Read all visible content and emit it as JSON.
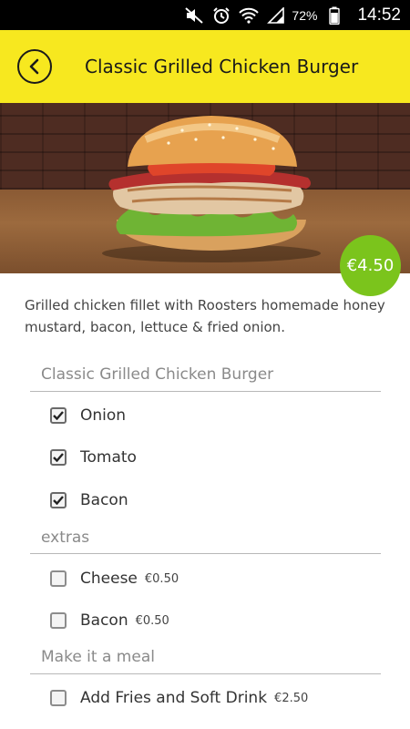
{
  "status_bar": {
    "icons": [
      "mute-icon",
      "alarm-icon",
      "wifi-icon",
      "signal-icon",
      "battery-icon"
    ],
    "battery": "72%",
    "time": "14:52"
  },
  "header": {
    "title": "Classic Grilled Chicken Burger",
    "back_icon": "chevron-left-icon",
    "background": "#f7e81f"
  },
  "product": {
    "price": "€4.50",
    "price_color": "#7bc41c",
    "description": "Grilled chicken fillet with Roosters homemade honey mustard, bacon, lettuce & fried onion."
  },
  "sections": [
    {
      "title": "Classic Grilled Chicken Burger",
      "options": [
        {
          "label": "Onion",
          "price": "",
          "checked": true
        },
        {
          "label": "Tomato",
          "price": "",
          "checked": true
        },
        {
          "label": "Bacon",
          "price": "",
          "checked": true
        }
      ]
    },
    {
      "title": "extras",
      "options": [
        {
          "label": "Cheese",
          "price": "€0.50",
          "checked": false
        },
        {
          "label": "Bacon",
          "price": "€0.50",
          "checked": false
        }
      ]
    },
    {
      "title": "Make it a meal",
      "options": [
        {
          "label": "Add Fries and Soft Drink",
          "price": "€2.50",
          "checked": false
        }
      ]
    }
  ]
}
